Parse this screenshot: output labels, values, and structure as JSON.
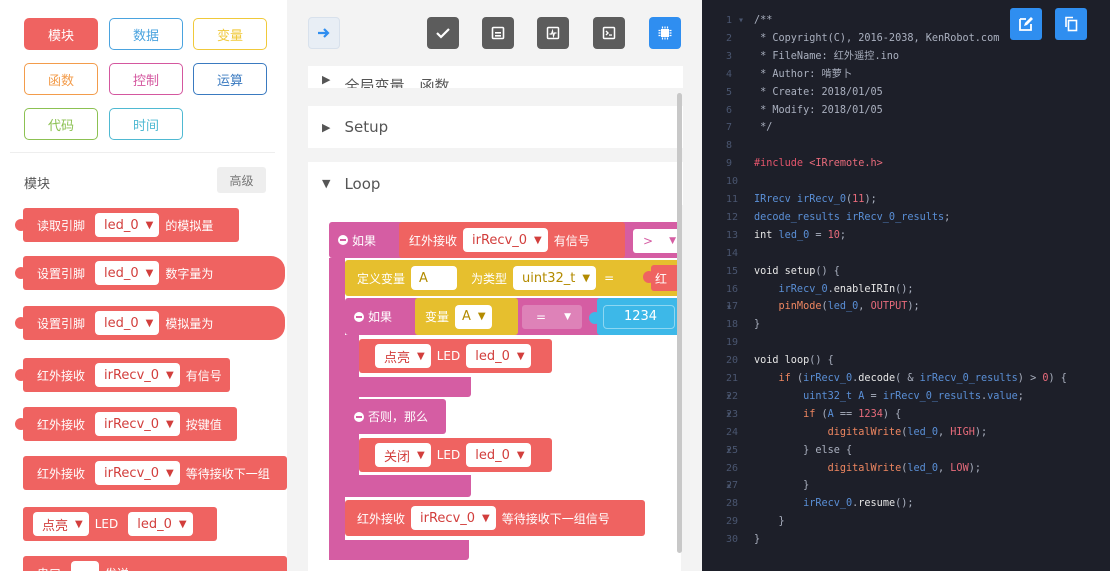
{
  "palette": {
    "categories": [
      {
        "label": "模块",
        "color": "#ef6361",
        "active": true
      },
      {
        "label": "数据",
        "color": "#4aa3df",
        "active": false
      },
      {
        "label": "变量",
        "color": "#f0c93a",
        "active": false
      },
      {
        "label": "函数",
        "color": "#f39c4b",
        "active": false
      },
      {
        "label": "控制",
        "color": "#d4579f",
        "active": false
      },
      {
        "label": "运算",
        "color": "#3a7ac0",
        "active": false
      },
      {
        "label": "代码",
        "color": "#8cc152",
        "active": false
      },
      {
        "label": "时间",
        "color": "#4fb9d2",
        "active": false
      }
    ],
    "section_title": "模块",
    "advanced_label": "高级",
    "blocks": [
      {
        "prefix": "读取引脚",
        "dropdown": "led_0",
        "suffix": "的模拟量"
      },
      {
        "prefix": "设置引脚",
        "dropdown": "led_0",
        "suffix": "数字量为"
      },
      {
        "prefix": "设置引脚",
        "dropdown": "led_0",
        "suffix": "模拟量为"
      },
      {
        "prefix": "红外接收",
        "dropdown": "irRecv_0",
        "suffix": "有信号"
      },
      {
        "prefix": "红外接收",
        "dropdown": "irRecv_0",
        "suffix": "按键值"
      },
      {
        "prefix": "红外接收",
        "dropdown": "irRecv_0",
        "suffix": "等待接收下一组"
      },
      {
        "dropdown1": "点亮",
        "middle": "LED",
        "dropdown2": "led_0"
      },
      {
        "prefix": "串口",
        "dropdown": "",
        "suffix": "发送"
      }
    ]
  },
  "toolbar": {
    "arrow_icon": "arrow-right-icon",
    "buttons": [
      "check-icon",
      "save-icon",
      "monitor-icon",
      "terminal-icon",
      "chip-icon"
    ]
  },
  "workspace": {
    "sections": [
      {
        "label": "全局变量、函数",
        "expanded": false
      },
      {
        "label": "Setup",
        "expanded": false
      },
      {
        "label": "Loop",
        "expanded": true
      }
    ],
    "if_label": "如果",
    "ir_recv_label": "红外接收",
    "ir_recv_var": "irRecv_0",
    "has_signal": "有信号",
    "gt_op": ">",
    "define_var_label": "定义变量",
    "var_name": "A",
    "type_label": "为类型",
    "type_value": "uint32_t",
    "eq_op": "=",
    "trailing_char": "红",
    "inner_if_label": "如果",
    "var_label": "变量",
    "var_ref": "A",
    "compare_op": "=",
    "compare_value": "1234",
    "light_on": "点亮",
    "led_label": "LED",
    "led_var": "led_0",
    "else_label": "否则，那么",
    "light_off": "关闭",
    "wait_label": "红外接收",
    "wait_var": "irRecv_0",
    "wait_suffix": "等待接收下一组信号"
  },
  "editor": {
    "lines": [
      {
        "n": "1",
        "fold": true,
        "parts": [
          [
            "c-com",
            "/**"
          ]
        ]
      },
      {
        "n": "2",
        "parts": [
          [
            "c-com",
            " * Copyright(C), 2016-2038, KenRobot.com"
          ]
        ]
      },
      {
        "n": "3",
        "parts": [
          [
            "c-com",
            " * FileName: 红外遥控.ino"
          ]
        ]
      },
      {
        "n": "4",
        "parts": [
          [
            "c-com",
            " * Author: 啃萝卜"
          ]
        ]
      },
      {
        "n": "5",
        "parts": [
          [
            "c-com",
            " * Create: 2018/01/05"
          ]
        ]
      },
      {
        "n": "6",
        "parts": [
          [
            "c-com",
            " * Modify: 2018/01/05"
          ]
        ]
      },
      {
        "n": "7",
        "parts": [
          [
            "c-com",
            " */"
          ]
        ]
      },
      {
        "n": "8",
        "parts": []
      },
      {
        "n": "9",
        "parts": [
          [
            "c-pre",
            "#include "
          ],
          [
            "c-txt",
            "<IRremote.h>"
          ]
        ]
      },
      {
        "n": "10",
        "parts": []
      },
      {
        "n": "11",
        "parts": [
          [
            "c-blu",
            "IRrecv irRecv_0"
          ],
          [
            "c-gray",
            "("
          ],
          [
            "c-txt",
            "11"
          ],
          [
            "c-gray",
            ");"
          ]
        ]
      },
      {
        "n": "12",
        "parts": [
          [
            "c-blu",
            "decode_results irRecv_0_results"
          ],
          [
            "c-gray",
            ";"
          ]
        ]
      },
      {
        "n": "13",
        "parts": [
          [
            "c-white",
            "int "
          ],
          [
            "c-blu",
            "led_0"
          ],
          [
            "c-gray",
            " = "
          ],
          [
            "c-txt",
            "10"
          ],
          [
            "c-gray",
            ";"
          ]
        ]
      },
      {
        "n": "14",
        "parts": []
      },
      {
        "n": "15",
        "parts": [
          [
            "c-white",
            "void "
          ],
          [
            "c-white",
            "setup"
          ],
          [
            "c-gray",
            "() {"
          ]
        ]
      },
      {
        "n": "16",
        "fold": true,
        "parts": [
          [
            "c-blu",
            "    irRecv_0"
          ],
          [
            "c-gray",
            "."
          ],
          [
            "c-white",
            "enableIRIn"
          ],
          [
            "c-gray",
            "();"
          ]
        ]
      },
      {
        "n": "17",
        "parts": [
          [
            "c-fn",
            "    pinMode"
          ],
          [
            "c-gray",
            "("
          ],
          [
            "c-blu",
            "led_0"
          ],
          [
            "c-gray",
            ", "
          ],
          [
            "c-txt",
            "OUTPUT"
          ],
          [
            "c-gray",
            ");"
          ]
        ]
      },
      {
        "n": "18",
        "parts": [
          [
            "c-gray",
            "}"
          ]
        ]
      },
      {
        "n": "19",
        "parts": []
      },
      {
        "n": "20",
        "parts": [
          [
            "c-white",
            "void "
          ],
          [
            "c-white",
            "loop"
          ],
          [
            "c-gray",
            "() {"
          ]
        ]
      },
      {
        "n": "21",
        "fold": true,
        "parts": [
          [
            "c-fn",
            "    if "
          ],
          [
            "c-gray",
            "("
          ],
          [
            "c-blu",
            "irRecv_0"
          ],
          [
            "c-gray",
            "."
          ],
          [
            "c-white",
            "decode"
          ],
          [
            "c-gray",
            "( & "
          ],
          [
            "c-blu",
            "irRecv_0_results"
          ],
          [
            "c-gray",
            ") > "
          ],
          [
            "c-txt",
            "0"
          ],
          [
            "c-gray",
            ") {"
          ]
        ]
      },
      {
        "n": "22",
        "fold": true,
        "parts": [
          [
            "c-blu",
            "        uint32_t A"
          ],
          [
            "c-gray",
            " = "
          ],
          [
            "c-blu",
            "irRecv_0_results"
          ],
          [
            "c-gray",
            "."
          ],
          [
            "c-blu",
            "value"
          ],
          [
            "c-gray",
            ";"
          ]
        ]
      },
      {
        "n": "23",
        "parts": [
          [
            "c-fn",
            "        if "
          ],
          [
            "c-gray",
            "("
          ],
          [
            "c-blu",
            "A"
          ],
          [
            "c-gray",
            " == "
          ],
          [
            "c-txt",
            "1234"
          ],
          [
            "c-gray",
            ") {"
          ]
        ]
      },
      {
        "n": "24",
        "fold": true,
        "parts": [
          [
            "c-fn",
            "            digitalWrite"
          ],
          [
            "c-gray",
            "("
          ],
          [
            "c-blu",
            "led_0"
          ],
          [
            "c-gray",
            ", "
          ],
          [
            "c-txt",
            "HIGH"
          ],
          [
            "c-gray",
            ");"
          ]
        ]
      },
      {
        "n": "25",
        "parts": [
          [
            "c-gray",
            "        } else {"
          ]
        ]
      },
      {
        "n": "26",
        "fold": true,
        "parts": [
          [
            "c-fn",
            "            digitalWrite"
          ],
          [
            "c-gray",
            "("
          ],
          [
            "c-blu",
            "led_0"
          ],
          [
            "c-gray",
            ", "
          ],
          [
            "c-txt",
            "LOW"
          ],
          [
            "c-gray",
            ");"
          ]
        ]
      },
      {
        "n": "27",
        "parts": [
          [
            "c-gray",
            "        }"
          ]
        ]
      },
      {
        "n": "28",
        "parts": [
          [
            "c-blu",
            "        irRecv_0"
          ],
          [
            "c-gray",
            "."
          ],
          [
            "c-white",
            "resume"
          ],
          [
            "c-gray",
            "();"
          ]
        ]
      },
      {
        "n": "29",
        "parts": [
          [
            "c-gray",
            "    }"
          ]
        ]
      },
      {
        "n": "30",
        "parts": [
          [
            "c-gray",
            "}"
          ]
        ]
      }
    ]
  },
  "colors": {
    "module": "#ef6361",
    "control": "#d55da3",
    "variable": "#e6bf2e",
    "operator": "#3db8e8",
    "toolbar_gray": "#5c5c5c",
    "toolbar_blue": "#2f8ef0",
    "editor_bg": "#1d1f29"
  }
}
